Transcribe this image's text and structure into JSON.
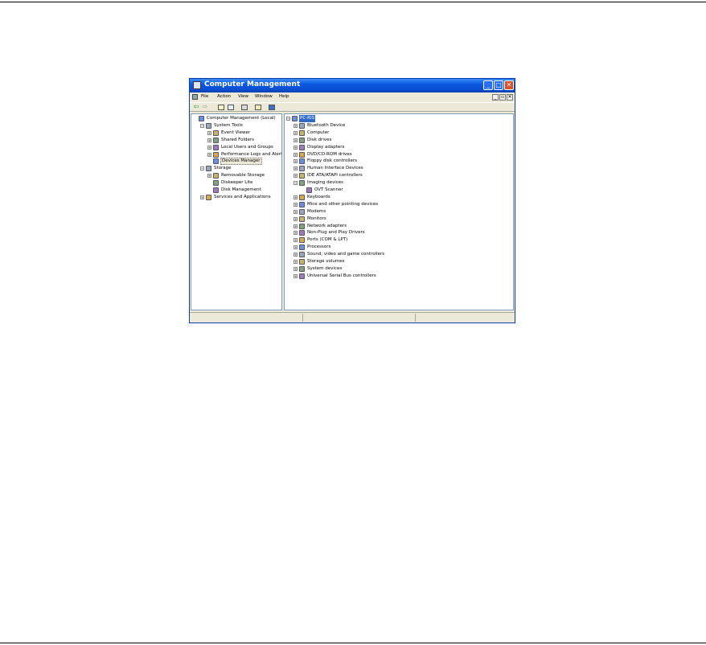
{
  "window": {
    "title": "Computer Management",
    "controls": {
      "minimize": "_",
      "maximize": "□",
      "close": "✕"
    }
  },
  "menubar": {
    "items": [
      "File",
      "Action",
      "View",
      "Window",
      "Help"
    ],
    "mdi": {
      "minimize": "_",
      "restore": "▫",
      "close": "✕"
    }
  },
  "toolbar": {
    "back": "⇦",
    "forward": "⇨",
    "icons": [
      "up-folder-icon",
      "show-hide-tree-icon",
      "print-icon",
      "properties-icon",
      "help-icon"
    ]
  },
  "left_tree": [
    {
      "label": "Computer Management (Local)",
      "depth": 0,
      "expander": "",
      "icon": "computer-management-icon"
    },
    {
      "label": "System Tools",
      "depth": 1,
      "expander": "−",
      "icon": "system-tools-icon"
    },
    {
      "label": "Event Viewer",
      "depth": 2,
      "expander": "+",
      "icon": "event-viewer-icon"
    },
    {
      "label": "Shared Folders",
      "depth": 2,
      "expander": "+",
      "icon": "shared-folders-icon"
    },
    {
      "label": "Local Users and Groups",
      "depth": 2,
      "expander": "+",
      "icon": "users-groups-icon"
    },
    {
      "label": "Performance Logs and Alerts",
      "depth": 2,
      "expander": "+",
      "icon": "performance-icon"
    },
    {
      "label": "Devices Manager",
      "depth": 2,
      "expander": "",
      "icon": "device-manager-icon",
      "selected": true
    },
    {
      "label": "Storage",
      "depth": 1,
      "expander": "−",
      "icon": "storage-icon"
    },
    {
      "label": "Removable Storage",
      "depth": 2,
      "expander": "+",
      "icon": "removable-storage-icon"
    },
    {
      "label": "Diskeeper Lite",
      "depth": 2,
      "expander": "",
      "icon": "diskeeper-icon"
    },
    {
      "label": "Disk Management",
      "depth": 2,
      "expander": "",
      "icon": "disk-management-icon"
    },
    {
      "label": "Services and Applications",
      "depth": 1,
      "expander": "+",
      "icon": "services-icon"
    }
  ],
  "right_tree": [
    {
      "label": "PC-RIS",
      "depth": 0,
      "expander": "−",
      "icon": "computer-icon",
      "highlight": true
    },
    {
      "label": "Bluetooth Device",
      "depth": 1,
      "expander": "+",
      "icon": "bluetooth-icon"
    },
    {
      "label": "Computer",
      "depth": 1,
      "expander": "+",
      "icon": "computer-icon"
    },
    {
      "label": "Disk drives",
      "depth": 1,
      "expander": "+",
      "icon": "disk-drive-icon"
    },
    {
      "label": "Display adapters",
      "depth": 1,
      "expander": "+",
      "icon": "display-adapter-icon"
    },
    {
      "label": "DVD/CD-ROM drives",
      "depth": 1,
      "expander": "+",
      "icon": "cdrom-icon"
    },
    {
      "label": "Floppy disk controllers",
      "depth": 1,
      "expander": "+",
      "icon": "floppy-controller-icon"
    },
    {
      "label": "Human Interface Devices",
      "depth": 1,
      "expander": "+",
      "icon": "hid-icon"
    },
    {
      "label": "IDE ATA/ATAPI controllers",
      "depth": 1,
      "expander": "+",
      "icon": "ide-controller-icon"
    },
    {
      "label": "Imaging devices",
      "depth": 1,
      "expander": "−",
      "icon": "imaging-devices-icon"
    },
    {
      "label": "OVT Scanner",
      "depth": 2,
      "expander": "",
      "icon": "scanner-warning-icon"
    },
    {
      "label": "Keyboards",
      "depth": 1,
      "expander": "+",
      "icon": "keyboard-icon"
    },
    {
      "label": "Mice and other pointing devices",
      "depth": 1,
      "expander": "+",
      "icon": "mouse-icon"
    },
    {
      "label": "Modems",
      "depth": 1,
      "expander": "+",
      "icon": "modem-icon"
    },
    {
      "label": "Monitors",
      "depth": 1,
      "expander": "+",
      "icon": "monitor-icon"
    },
    {
      "label": "Network adapters",
      "depth": 1,
      "expander": "+",
      "icon": "network-adapter-icon"
    },
    {
      "label": "Non-Plug and Play Drivers",
      "depth": 1,
      "expander": "+",
      "icon": "non-pnp-icon"
    },
    {
      "label": "Ports (COM & LPT)",
      "depth": 1,
      "expander": "+",
      "icon": "ports-icon"
    },
    {
      "label": "Processors",
      "depth": 1,
      "expander": "+",
      "icon": "processor-icon"
    },
    {
      "label": "Sound, video and game controllers",
      "depth": 1,
      "expander": "+",
      "icon": "sound-icon"
    },
    {
      "label": "Storage volumes",
      "depth": 1,
      "expander": "+",
      "icon": "storage-volume-icon"
    },
    {
      "label": "System devices",
      "depth": 1,
      "expander": "+",
      "icon": "system-devices-icon"
    },
    {
      "label": "Universal Serial Bus controllers",
      "depth": 1,
      "expander": "+",
      "icon": "usb-icon"
    }
  ],
  "scrollbar": {
    "left": "‹",
    "right": "›"
  },
  "colors": {
    "titlebar": "#0a58e0",
    "selection": "#316ac5",
    "chrome": "#ece9d8",
    "icon_colors": [
      "#6b8fd8",
      "#9aa7b8",
      "#c9b46a",
      "#7fa37a",
      "#a07ab8",
      "#d8a84a"
    ]
  }
}
